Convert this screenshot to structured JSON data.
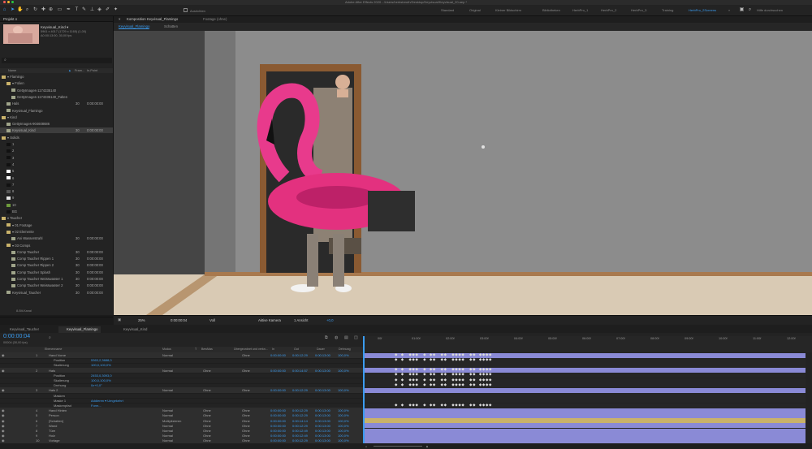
{
  "app": {
    "title": "Adobe After Effects 2020 - /Users/herbstreuth/Desktop/Keyvisual/Keyvisual_20.aep *"
  },
  "toolbar": {
    "align_label": "Ausrichten",
    "workspaces": [
      "Standard",
      "Original",
      "Kleiner Bildschirm",
      "Bibliotheken",
      "HerbPro_1",
      "HerbPro_2",
      "HerbPro_3",
      "Training",
      "HerbPro_2Screens"
    ],
    "active_workspace": "HerbPro_2Screens",
    "search_placeholder": "Hilfe durchsuchen"
  },
  "project": {
    "tab": "Projekt ≡",
    "selected_item": "Keyvisual_Kind ▾",
    "selected_info1": "5961 x 4017 (1729 x 1165) (1,00)",
    "selected_info2": "Δ0:00:13:00, 30,00 fps",
    "col_name": "Name",
    "col_frames": "Fram...",
    "col_inpoint": "In-Point",
    "search_placeholder": "⌕",
    "items": [
      {
        "name": "Flamingo",
        "type": "folder",
        "level": 0,
        "color": "#c9b26a",
        "fr": "",
        "inp": ""
      },
      {
        "name": "Folien",
        "type": "folder",
        "level": 1,
        "color": "#c9b26a",
        "fr": "",
        "inp": ""
      },
      {
        "name": "GettyImages-1174335140",
        "type": "image",
        "level": 2,
        "color": "#9fa48a",
        "fr": "",
        "inp": ""
      },
      {
        "name": "GettyImages-1174335140_Falten",
        "type": "image",
        "level": 2,
        "color": "#9fa48a",
        "fr": "",
        "inp": ""
      },
      {
        "name": "Hals",
        "type": "comp",
        "level": 1,
        "color": "#9fa48a",
        "fr": "30",
        "inp": "0:00:00:00"
      },
      {
        "name": "Keyvisual_Flamingo",
        "type": "comp",
        "level": 1,
        "color": "#9fa48a",
        "fr": "",
        "inp": ""
      },
      {
        "name": "Kind",
        "type": "folder",
        "level": 0,
        "color": "#c9b26a",
        "fr": "",
        "inp": ""
      },
      {
        "name": "GettyImages-904608686",
        "type": "image",
        "level": 1,
        "color": "#9fa48a",
        "fr": "",
        "inp": ""
      },
      {
        "name": "Keyvisual_Kind",
        "type": "comp",
        "level": 1,
        "color": "#9fa48a",
        "fr": "30",
        "inp": "0:00:00:00"
      },
      {
        "name": "Solids",
        "type": "folder",
        "level": 0,
        "color": "#c9b26a",
        "fr": "",
        "inp": ""
      },
      {
        "name": "1",
        "type": "solid",
        "level": 1,
        "color": "#111111",
        "fr": "",
        "inp": ""
      },
      {
        "name": "2",
        "type": "solid",
        "level": 1,
        "color": "#111111",
        "fr": "",
        "inp": ""
      },
      {
        "name": "3",
        "type": "solid",
        "level": 1,
        "color": "#111111",
        "fr": "",
        "inp": ""
      },
      {
        "name": "4",
        "type": "solid",
        "level": 1,
        "color": "#111111",
        "fr": "",
        "inp": ""
      },
      {
        "name": "5",
        "type": "solid",
        "level": 1,
        "color": "#ffffff",
        "fr": "",
        "inp": ""
      },
      {
        "name": "6",
        "type": "solid",
        "level": 1,
        "color": "#ffffff",
        "fr": "",
        "inp": ""
      },
      {
        "name": "7",
        "type": "solid",
        "level": 1,
        "color": "#111111",
        "fr": "",
        "inp": ""
      },
      {
        "name": "8",
        "type": "solid",
        "level": 1,
        "color": "#555555",
        "fr": "",
        "inp": ""
      },
      {
        "name": "9",
        "type": "solid",
        "level": 1,
        "color": "#e5e5e5",
        "fr": "",
        "inp": ""
      },
      {
        "name": "10",
        "type": "solid",
        "level": 1,
        "color": "#6e9b3c",
        "fr": "",
        "inp": ""
      },
      {
        "name": "BG",
        "type": "solid",
        "level": 1,
        "color": "#111111",
        "fr": "",
        "inp": ""
      },
      {
        "name": "Taucher",
        "type": "folder",
        "level": 0,
        "color": "#c9b26a",
        "fr": "",
        "inp": ""
      },
      {
        "name": "01 Footage",
        "type": "folder",
        "level": 1,
        "color": "#c9b26a",
        "fr": "",
        "inp": ""
      },
      {
        "name": "02 Elemente",
        "type": "folder",
        "level": 1,
        "color": "#c9b26a",
        "fr": "",
        "inp": ""
      },
      {
        "name": "Ani Wasserstrahl",
        "type": "comp",
        "level": 2,
        "color": "#9fa48a",
        "fr": "30",
        "inp": "0:00:00:00"
      },
      {
        "name": "03 Comps",
        "type": "folder",
        "level": 1,
        "color": "#c9b26a",
        "fr": "",
        "inp": ""
      },
      {
        "name": "Comp Taucher",
        "type": "comp",
        "level": 2,
        "color": "#9fa48a",
        "fr": "30",
        "inp": "0:00:00:00"
      },
      {
        "name": "Comp Taucher Rippen 1",
        "type": "comp",
        "level": 2,
        "color": "#9fa48a",
        "fr": "30",
        "inp": "0:00:00:00"
      },
      {
        "name": "Comp Taucher Rippen 2",
        "type": "comp",
        "level": 2,
        "color": "#9fa48a",
        "fr": "30",
        "inp": "0:00:00:00"
      },
      {
        "name": "Comp Taucher Splash",
        "type": "comp",
        "level": 2,
        "color": "#9fa48a",
        "fr": "30",
        "inp": "0:00:00:00"
      },
      {
        "name": "Comp Taucher Weisswasser 1",
        "type": "comp",
        "level": 2,
        "color": "#9fa48a",
        "fr": "30",
        "inp": "0:00:00:00"
      },
      {
        "name": "Comp Taucher Weisswasser 2",
        "type": "comp",
        "level": 2,
        "color": "#9fa48a",
        "fr": "30",
        "inp": "0:00:00:00"
      },
      {
        "name": "Keyvisual_Taucher",
        "type": "comp",
        "level": 1,
        "color": "#9fa48a",
        "fr": "30",
        "inp": "0:00:00:00"
      }
    ],
    "bit_depth": "8-Bit-Kanal"
  },
  "composition": {
    "panel_tab": "Komposition Keyvisual_Flamingo",
    "footage_tab": "Footage (ohne)",
    "breadcrumb": [
      "Keyvisual_Flamingo",
      "Schatten"
    ],
    "zoom": "25%",
    "time": "0:00:00:04",
    "resolution": "Voll",
    "camera": "Aktive Kamera",
    "views": "1 Ansicht",
    "exposure": "+0,0"
  },
  "timeline": {
    "tabs": [
      "Keyvisual_Taucher",
      "Keyvisual_Flamingo",
      "Keyvisual_Kind"
    ],
    "active_tab": "Keyvisual_Flamingo",
    "timecode": "0:00:00:04",
    "fps_info": "00004 (30,00 fps)",
    "search_placeholder": "⌕",
    "col_layername": "Ebenenname",
    "col_mode": "Modus",
    "col_t": "T",
    "col_trkmat": "BewMas",
    "col_parent": "Übergeordnet und verkn...",
    "col_in": "In",
    "col_out": "Out",
    "col_duration": "Dauer",
    "col_stretch": "Dehnung",
    "ruler": [
      "00f",
      "01:00f",
      "02:00f",
      "03:00f",
      "04:00f",
      "05:00f",
      "06:00f",
      "07:00f",
      "08:00f",
      "09:00f",
      "10:00f",
      "11:00f",
      "12:00f",
      "13:0"
    ],
    "layers": [
      {
        "num": "1",
        "name": "Hand Vorne",
        "mode": "Normal",
        "trk": "",
        "parent": "Ohne",
        "in": "0:00:00:00",
        "out": "0:00:12:29",
        "dur": "0:00:13:00",
        "str": "100,0%",
        "type": "layer",
        "color": "#8a8ad6",
        "kf": true
      },
      {
        "num": "",
        "name": "Position",
        "value": "5363,2,3688,0",
        "type": "prop",
        "color": "#8a8ad6",
        "kf": true
      },
      {
        "num": "",
        "name": "Skalierung",
        "value": "100,0,100,0%",
        "type": "prop",
        "color": "#8a8ad6",
        "kf": false
      },
      {
        "num": "2",
        "name": "Hals",
        "mode": "Normal",
        "trk": "Ohne",
        "parent": "Ohne",
        "in": "0:00:00:00",
        "out": "0:00:14:57",
        "dur": "0:00:13:00",
        "str": "100,0%",
        "type": "layer",
        "color": "#8a8ad6",
        "kf": true
      },
      {
        "num": "",
        "name": "Position",
        "value": "2453,0,3093,0",
        "type": "prop",
        "color": "#8a8ad6",
        "kf": true
      },
      {
        "num": "",
        "name": "Skalierung",
        "value": "100,0,100,0%",
        "type": "prop",
        "color": "#8a8ad6",
        "kf": true
      },
      {
        "num": "",
        "name": "Drehung",
        "value": "0x+0,0°",
        "type": "prop",
        "color": "#8a8ad6",
        "kf": true
      },
      {
        "num": "3",
        "name": "Hals 2",
        "mode": "Normal",
        "trk": "Ohne",
        "parent": "Ohne",
        "in": "0:00:00:00",
        "out": "0:00:12:29",
        "dur": "0:00:13:00",
        "str": "100,0%",
        "type": "layer",
        "color": "#8a8ad6",
        "kf": false
      },
      {
        "num": "",
        "name": "Masken",
        "value": "",
        "type": "group",
        "color": "#8a8ad6",
        "kf": false
      },
      {
        "num": "",
        "name": "Maske 1",
        "value": "Addieren ▾    Umgekehrt",
        "type": "prop",
        "color": "#8a8ad6",
        "kf": false
      },
      {
        "num": "",
        "name": "Maskenpfad",
        "value": "Form...",
        "type": "prop",
        "color": "#8a8ad6",
        "kf": true
      },
      {
        "num": "4",
        "name": "Hand Hinten",
        "mode": "Normal",
        "trk": "Ohne",
        "parent": "Ohne",
        "in": "0:00:00:00",
        "out": "0:00:12:29",
        "dur": "0:00:13:00",
        "str": "100,0%",
        "type": "layer",
        "color": "#8a8ad6",
        "kf": false
      },
      {
        "num": "5",
        "name": "Person",
        "mode": "Normal",
        "trk": "Ohne",
        "parent": "Ohne",
        "in": "0:00:00:00",
        "out": "0:00:12:29",
        "dur": "0:00:13:00",
        "str": "100,0%",
        "type": "layer",
        "color": "#8a8ad6",
        "kf": false
      },
      {
        "num": "6",
        "name": "[Schatten]",
        "mode": "Multiplizieren",
        "trk": "Ohne",
        "parent": "Ohne",
        "in": "0:00:00:00",
        "out": "0:00:14:14",
        "dur": "0:00:13:00",
        "str": "100,0%",
        "type": "layer",
        "color": "#c9b26a",
        "kf": false
      },
      {
        "num": "7",
        "name": "Wand",
        "mode": "Normal",
        "trk": "Ohne",
        "parent": "Ohne",
        "in": "0:00:00:00",
        "out": "0:00:12:29",
        "dur": "0:00:13:00",
        "str": "100,0%",
        "type": "layer",
        "color": "#8a8ad6",
        "kf": false
      },
      {
        "num": "8",
        "name": "Türe",
        "mode": "Normal",
        "trk": "Ohne",
        "parent": "Ohne",
        "in": "0:00:00:00",
        "out": "0:00:12:49",
        "dur": "0:00:13:00",
        "str": "100,0%",
        "type": "layer",
        "color": "#8a8ad6",
        "kf": false
      },
      {
        "num": "9",
        "name": "Holz",
        "mode": "Normal",
        "trk": "Ohne",
        "parent": "Ohne",
        "in": "0:00:00:00",
        "out": "0:00:12:49",
        "dur": "0:00:13:00",
        "str": "100,0%",
        "type": "layer",
        "color": "#8a8ad6",
        "kf": false
      },
      {
        "num": "10",
        "name": "Vorlage",
        "mode": "Normal",
        "trk": "Ohne",
        "parent": "Ohne",
        "in": "0:00:00:00",
        "out": "0:00:12:29",
        "dur": "0:00:13:00",
        "str": "100,0%",
        "type": "layer",
        "color": "#8a8ad6",
        "kf": false
      }
    ]
  }
}
